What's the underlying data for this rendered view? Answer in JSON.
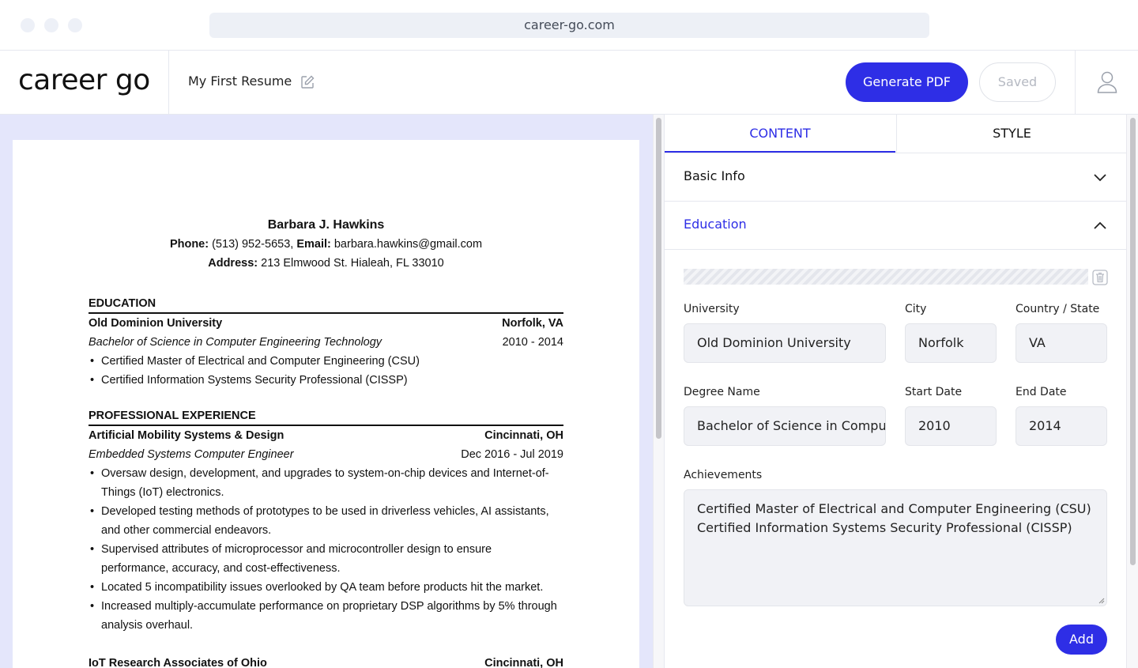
{
  "browser": {
    "url": "career-go.com"
  },
  "header": {
    "logo": "career go",
    "resume_title": "My First Resume",
    "generate_pdf_label": "Generate PDF",
    "saved_label": "Saved"
  },
  "resume": {
    "name": "Barbara J. Hawkins",
    "phone_label": "Phone:",
    "phone": " (513) 952-5653,",
    "email_label": "Email:",
    "email": " barbara.hawkins@gmail.com",
    "address_label": "Address:",
    "address": " 213 Elmwood St. Hialeah, FL 33010",
    "education_heading": "EDUCATION",
    "education": {
      "school": "Old Dominion University",
      "location": "Norfolk, VA",
      "degree": "Bachelor of Science in Computer Engineering Technology",
      "dates": "2010 - 2014",
      "bullets": [
        "Certified Master of Electrical and Computer Engineering (CSU)",
        "Certified Information Systems Security Professional (CISSP)"
      ]
    },
    "experience_heading": "PROFESSIONAL EXPERIENCE",
    "jobs": [
      {
        "company": "Artificial Mobility Systems & Design",
        "location": "Cincinnati, OH",
        "title": "Embedded Systems Computer Engineer",
        "dates": "Dec 2016 - Jul 2019",
        "bullets": [
          [
            "Oversaw design, development, and upgrades to system-on-chip devices and Internet-of-",
            "Things (IoT) electronics."
          ],
          [
            "Developed testing methods of prototypes to be used in driverless vehicles, AI assistants,",
            "and other commercial endeavors."
          ],
          [
            "Supervised attributes of microprocessor and microcontroller design to ensure",
            "performance, accuracy, and cost-effectiveness."
          ],
          [
            "Located 5 incompatibility issues overlooked by QA team before products hit the market."
          ],
          [
            "Increased multiply-accumulate performance on proprietary DSP algorithms by 5% through",
            "analysis overhaul."
          ]
        ]
      },
      {
        "company": "IoT Research Associates of Ohio",
        "location": "Cincinnati, OH"
      }
    ]
  },
  "editor": {
    "tabs": {
      "content": "CONTENT",
      "style": "STYLE"
    },
    "sections": {
      "basic_info": "Basic Info",
      "education": "Education"
    },
    "labels": {
      "university": "University",
      "city": "City",
      "country_state": "Country / State",
      "degree_name": "Degree Name",
      "start_date": "Start Date",
      "end_date": "End Date",
      "achievements": "Achievements"
    },
    "values": {
      "university": "Old Dominion University",
      "city": "Norfolk",
      "country_state": "VA",
      "degree_name": "Bachelor of Science in Compu",
      "start_date": "2010",
      "end_date": "2014",
      "achievements": [
        "Certified Master of Electrical and Computer Engineering (CSU)",
        "Certified Information Systems Security Professional (CISSP)"
      ]
    },
    "add_label": "Add"
  },
  "colors": {
    "accent": "#2e2ee6",
    "preview_bg": "#e4e6fb"
  }
}
